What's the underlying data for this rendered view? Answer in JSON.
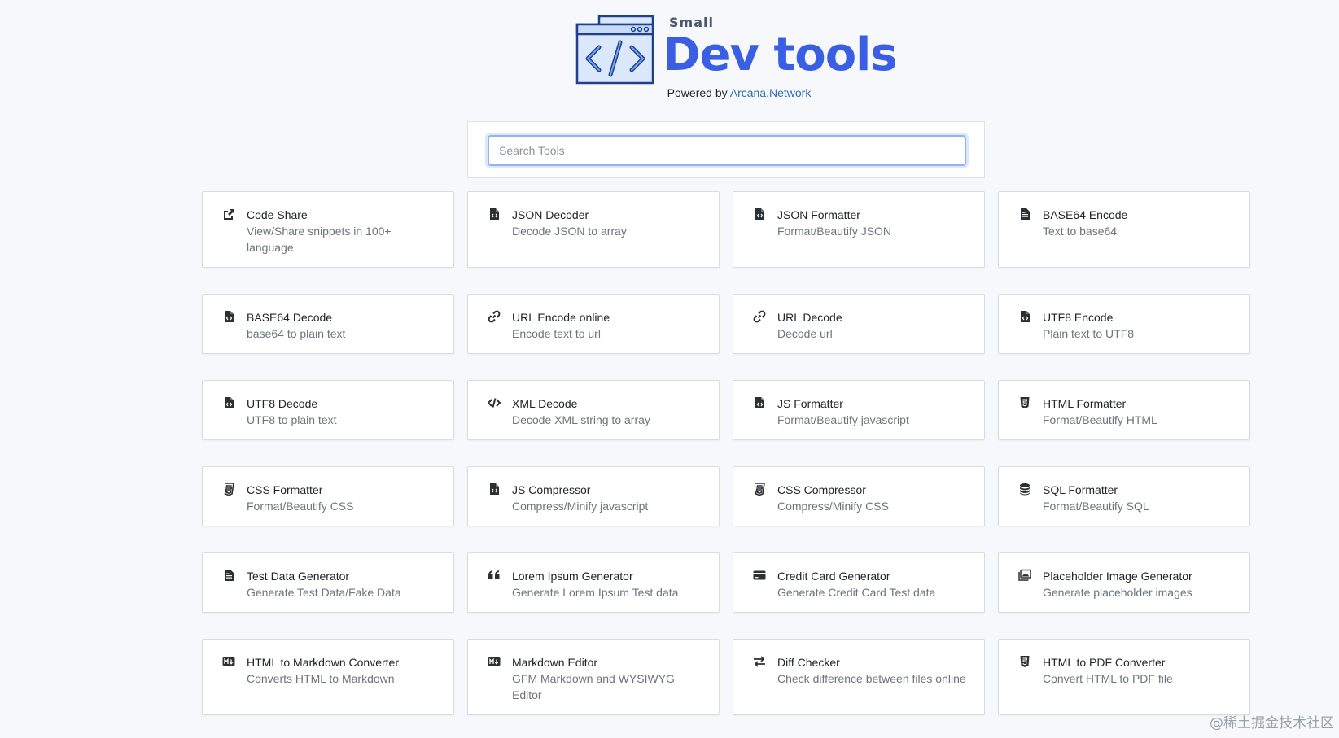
{
  "header": {
    "logo_small": "Small",
    "logo_title": "Dev tools",
    "powered_prefix": "Powered by",
    "powered_link": "Arcana.Network",
    "brand_color": "#3a5fe5"
  },
  "search": {
    "placeholder": "Search Tools",
    "value": ""
  },
  "tools": [
    {
      "title": "Code Share",
      "desc": "View/Share snippets in 100+ language",
      "icon": "share-square-icon"
    },
    {
      "title": "JSON Decoder",
      "desc": "Decode JSON to array",
      "icon": "file-code-icon"
    },
    {
      "title": "JSON Formatter",
      "desc": "Format/Beautify JSON",
      "icon": "file-code-icon"
    },
    {
      "title": "BASE64 Encode",
      "desc": "Text to base64",
      "icon": "file-text-icon"
    },
    {
      "title": "BASE64 Decode",
      "desc": "base64 to plain text",
      "icon": "file-code-icon"
    },
    {
      "title": "URL Encode online",
      "desc": "Encode text to url",
      "icon": "link-icon"
    },
    {
      "title": "URL Decode",
      "desc": "Decode url",
      "icon": "link-icon"
    },
    {
      "title": "UTF8 Encode",
      "desc": "Plain text to UTF8",
      "icon": "file-code-icon"
    },
    {
      "title": "UTF8 Decode",
      "desc": "UTF8 to plain text",
      "icon": "file-code-icon"
    },
    {
      "title": "XML Decode",
      "desc": "Decode XML string to array",
      "icon": "code-icon"
    },
    {
      "title": "JS Formatter",
      "desc": "Format/Beautify javascript",
      "icon": "file-code-icon"
    },
    {
      "title": "HTML Formatter",
      "desc": "Format/Beautify HTML",
      "icon": "html5-icon"
    },
    {
      "title": "CSS Formatter",
      "desc": "Format/Beautify CSS",
      "icon": "css3-icon"
    },
    {
      "title": "JS Compressor",
      "desc": "Compress/Minify javascript",
      "icon": "file-code-icon"
    },
    {
      "title": "CSS Compressor",
      "desc": "Compress/Minify CSS",
      "icon": "css3-icon"
    },
    {
      "title": "SQL Formatter",
      "desc": "Format/Beautify SQL",
      "icon": "database-icon"
    },
    {
      "title": "Test Data Generator",
      "desc": "Generate Test Data/Fake Data",
      "icon": "file-text-icon"
    },
    {
      "title": "Lorem Ipsum Generator",
      "desc": "Generate Lorem Ipsum Test data",
      "icon": "quote-left-icon"
    },
    {
      "title": "Credit Card Generator",
      "desc": "Generate Credit Card Test data",
      "icon": "credit-card-icon"
    },
    {
      "title": "Placeholder Image Generator",
      "desc": "Generate placeholder images",
      "icon": "images-icon"
    },
    {
      "title": "HTML to Markdown Converter",
      "desc": "Converts HTML to Markdown",
      "icon": "markdown-icon"
    },
    {
      "title": "Markdown Editor",
      "desc": "GFM Markdown and WYSIWYG Editor",
      "icon": "markdown-icon"
    },
    {
      "title": "Diff Checker",
      "desc": "Check difference between files online",
      "icon": "exchange-icon"
    },
    {
      "title": "HTML to PDF Converter",
      "desc": "Convert HTML to PDF file",
      "icon": "html5-icon"
    }
  ],
  "watermark": "@稀土掘金技术社区"
}
